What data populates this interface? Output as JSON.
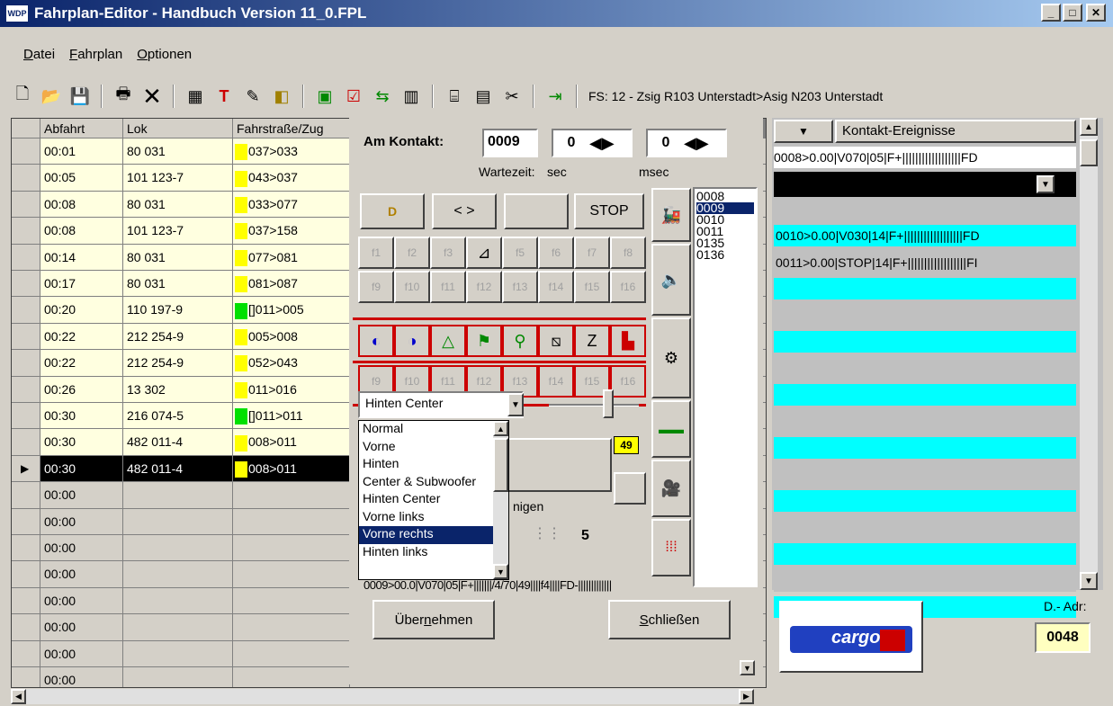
{
  "title": "Fahrplan-Editor - Handbuch Version 11_0.FPL",
  "app_logo": "WDP",
  "window_buttons": {
    "minimize": "_",
    "maximize": "□",
    "close": "✕"
  },
  "menu": [
    {
      "pre": "",
      "u": "D",
      "post": "atei"
    },
    {
      "pre": "",
      "u": "F",
      "post": "ahrplan"
    },
    {
      "pre": "",
      "u": "O",
      "post": "ptionen"
    }
  ],
  "toolbar": {
    "icons": [
      "new-file-icon",
      "open-folder-icon",
      "save-disk-icon",
      "print-icon",
      "delete-x-icon",
      "train-route-icon",
      "text-tool-icon",
      "pencil-icon",
      "window-icon",
      "signal-icon",
      "chart-icon",
      "arrows-icon",
      "building-icon",
      "printer2-icon",
      "panel-icon",
      "scissors-icon",
      "exit-icon"
    ],
    "status": "FS: 12 - Zsig R103 Unterstadt>Asig N203 Unterstadt"
  },
  "grid": {
    "headers": [
      "Abfahrt",
      "Lok",
      "Fahrstraße/Zug"
    ],
    "rows": [
      {
        "time": "00:01",
        "lok": "80 031",
        "route": "037>033",
        "ind": "yellow"
      },
      {
        "time": "00:05",
        "lok": "101 123-7",
        "route": "043>037",
        "ind": "yellow"
      },
      {
        "time": "00:08",
        "lok": "80 031",
        "route": "033>077",
        "ind": "yellow"
      },
      {
        "time": "00:08",
        "lok": "101 123-7",
        "route": "037>158",
        "ind": "yellow"
      },
      {
        "time": "00:14",
        "lok": "80 031",
        "route": "077>081",
        "ind": "yellow"
      },
      {
        "time": "00:17",
        "lok": "80 031",
        "route": "081>087",
        "ind": "yellow"
      },
      {
        "time": "00:20",
        "lok": "110 197-9",
        "route": "[]011>005",
        "ind": "green"
      },
      {
        "time": "00:22",
        "lok": "212 254-9",
        "route": "005>008",
        "ind": "yellow"
      },
      {
        "time": "00:22",
        "lok": "212 254-9",
        "route": "052>043",
        "ind": "yellow"
      },
      {
        "time": "00:26",
        "lok": "13 302",
        "route": "011>016",
        "ind": "yellow"
      },
      {
        "time": "00:30",
        "lok": "216 074-5",
        "route": "[]011>011",
        "ind": "green"
      },
      {
        "time": "00:30",
        "lok": "482 011-4",
        "route": "008>011",
        "ind": "yellow"
      },
      {
        "time": "00:30",
        "lok": "482 011-4",
        "route": "008>011",
        "ind": "yellow",
        "selected": true
      },
      {
        "time": "00:00",
        "lok": "",
        "route": "",
        "ind": ""
      },
      {
        "time": "00:00",
        "lok": "",
        "route": "",
        "ind": ""
      },
      {
        "time": "00:00",
        "lok": "",
        "route": "",
        "ind": ""
      },
      {
        "time": "00:00",
        "lok": "",
        "route": "",
        "ind": ""
      },
      {
        "time": "00:00",
        "lok": "",
        "route": "",
        "ind": ""
      },
      {
        "time": "00:00",
        "lok": "",
        "route": "",
        "ind": ""
      },
      {
        "time": "00:00",
        "lok": "",
        "route": "",
        "ind": ""
      },
      {
        "time": "00:00",
        "lok": "",
        "route": "",
        "ind": ""
      }
    ]
  },
  "dialog": {
    "kontakt_label": "Am Kontakt:",
    "kontakt_value": "0009",
    "sec_value": "0",
    "msec_value": "0",
    "wait_label": "Wartezeit:",
    "sec_label": "sec",
    "msec_label": "msec",
    "top_buttons": [
      "D",
      "< >",
      "",
      "STOP"
    ],
    "f_row1": [
      "f1",
      "f2",
      "f3",
      "",
      "f5",
      "f6",
      "f7",
      "f8"
    ],
    "f_row2": [
      "f9",
      "f10",
      "f11",
      "f12",
      "f13",
      "f14",
      "f15",
      "f16"
    ],
    "f_row3": [
      "f9",
      "f10",
      "f11",
      "f12",
      "f13",
      "f14",
      "f15",
      "f16"
    ],
    "sound_select": "Hinten Center",
    "sound_options": [
      "Normal",
      "Vorne",
      "Hinten",
      "Center & Subwoofer",
      "Hinten Center",
      "Vorne links",
      "Vorne rechts",
      "Hinten links"
    ],
    "selected_option": "Vorne rechts",
    "badge_value": "49",
    "partial_label": "nigen",
    "count_value": "5",
    "command_string": "0009>00.0|V070|05|F+|||||||/4/70|49||||f4||||FD-|||||||||||||",
    "btn_ok": {
      "pre": "Über",
      "u": "n",
      "post": "ehmen"
    },
    "btn_close": {
      "pre": "",
      "u": "S",
      "post": "chließen"
    },
    "contacts": [
      "0008",
      "0009",
      "0010",
      "0011",
      "0135",
      "0136"
    ],
    "selected_contact": "0009"
  },
  "events": {
    "header": "Kontakt-Ereignisse",
    "first": "0008>0.00|V070|05|F+||||||||||||||||||FD",
    "rows": [
      {
        "text": "",
        "color": "#000000"
      },
      {
        "text": "",
        "color": "#c0c0c0"
      },
      {
        "text": "0010>0.00|V030|14|F+||||||||||||||||||FD",
        "color": "#00ffff"
      },
      {
        "text": "0011>0.00|STOP|14|F+||||||||||||||||||FI",
        "color": "#c0c0c0"
      },
      {
        "text": "",
        "color": "#00ffff"
      },
      {
        "text": "",
        "color": "#c0c0c0"
      },
      {
        "text": "",
        "color": "#00ffff"
      },
      {
        "text": "",
        "color": "#c0c0c0"
      },
      {
        "text": "",
        "color": "#00ffff"
      },
      {
        "text": "",
        "color": "#c0c0c0"
      },
      {
        "text": "",
        "color": "#00ffff"
      },
      {
        "text": "",
        "color": "#c0c0c0"
      },
      {
        "text": "",
        "color": "#00ffff"
      },
      {
        "text": "",
        "color": "#c0c0c0"
      },
      {
        "text": "",
        "color": "#00ffff"
      },
      {
        "text": "",
        "color": "#c0c0c0"
      },
      {
        "text": "",
        "color": "#00ffff"
      }
    ]
  },
  "loco": {
    "brand": "cargo",
    "addr_label": "D.- Adr:",
    "addr": "0048"
  }
}
